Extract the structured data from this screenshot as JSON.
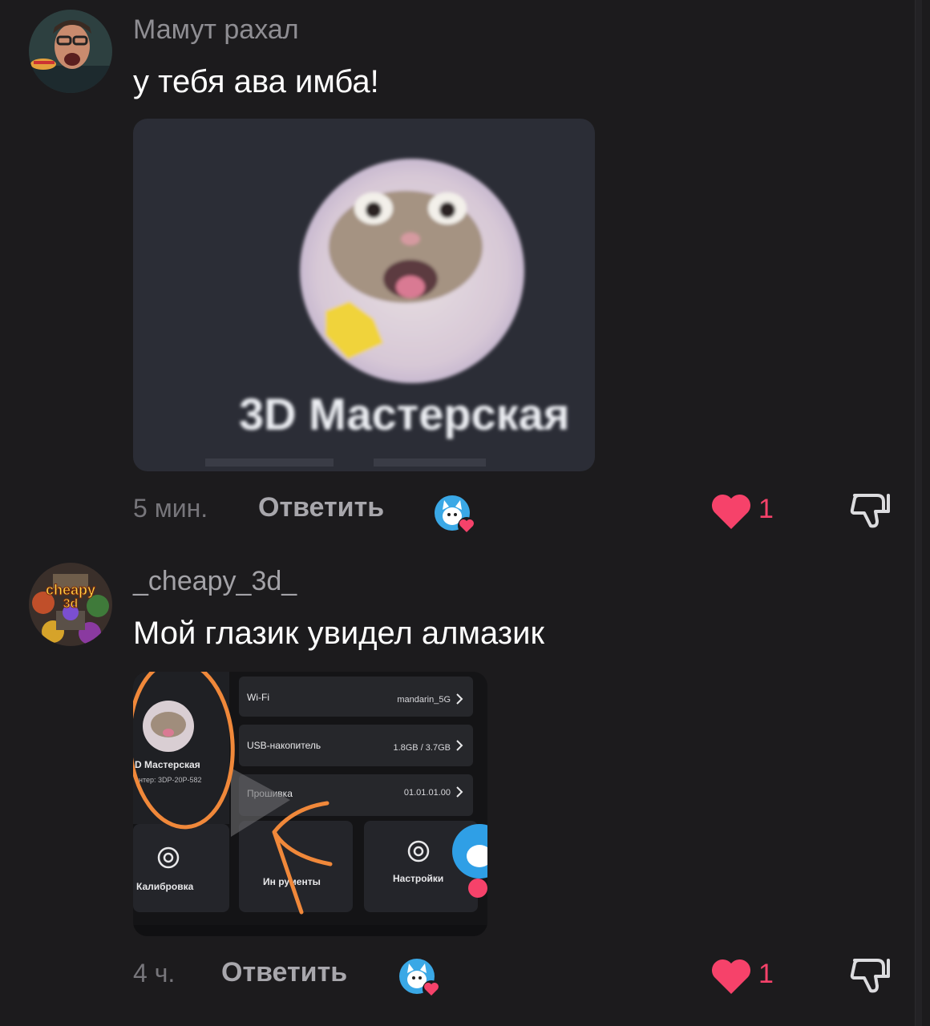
{
  "comments": [
    {
      "author": "Мамут рахал",
      "text": "у тебя ава имба!",
      "attachment_caption": "3D Мастерская",
      "time": "5 мин.",
      "reply_label": "Ответить",
      "likes": "1"
    },
    {
      "author": "_cheapy_3d_",
      "avatar_label_1": "cheapy",
      "avatar_label_2": "3d",
      "text": "Мой глазик увидел алмазик",
      "time": "4 ч.",
      "reply_label": "Ответить",
      "likes": "1",
      "screenshot": {
        "profile_name": "D Мастерская",
        "profile_sub": "интер: 3DP-20P-582",
        "rows": [
          {
            "label": "Wi-Fi",
            "value": "mandarin_5G"
          },
          {
            "label": "USB-накопитель",
            "value": "1.8GB / 3.7GB"
          },
          {
            "label": "Прошивка",
            "value": "01.01.01.00"
          }
        ],
        "tiles": [
          "Калибровка",
          "Ин  рументы",
          "Настройки"
        ]
      }
    }
  ],
  "colors": {
    "background": "#1c1b1d",
    "like": "#f6426a",
    "annotation": "#f0883a"
  },
  "icons": [
    "heart-icon",
    "dislike-icon",
    "chevron-right-icon",
    "gear-icon",
    "play-icon"
  ]
}
